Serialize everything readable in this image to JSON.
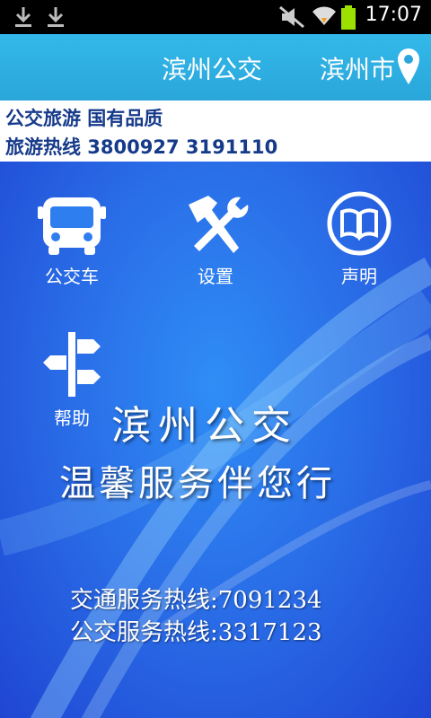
{
  "status_bar": {
    "time": "17:07"
  },
  "header": {
    "title": "滨州公交",
    "city": "滨州市"
  },
  "info": {
    "line1": "公交旅游 国有品质",
    "line2": "旅游热线 3800927  3191110"
  },
  "menu": [
    {
      "label": "公交车",
      "icon": "bus-icon"
    },
    {
      "label": "设置",
      "icon": "tools-icon"
    },
    {
      "label": "声明",
      "icon": "book-icon"
    },
    {
      "label": "帮助",
      "icon": "signpost-icon"
    }
  ],
  "slogan": {
    "line1": "滨州公交",
    "line2": "温馨服务伴您行"
  },
  "hotlines": [
    {
      "text": "交通服务热线:7091234"
    },
    {
      "text": "公交服务热线:3317123"
    }
  ],
  "colors": {
    "header": "#2aa6da",
    "main_bg": "#2a6fe8",
    "info_text": "#153a8a"
  }
}
